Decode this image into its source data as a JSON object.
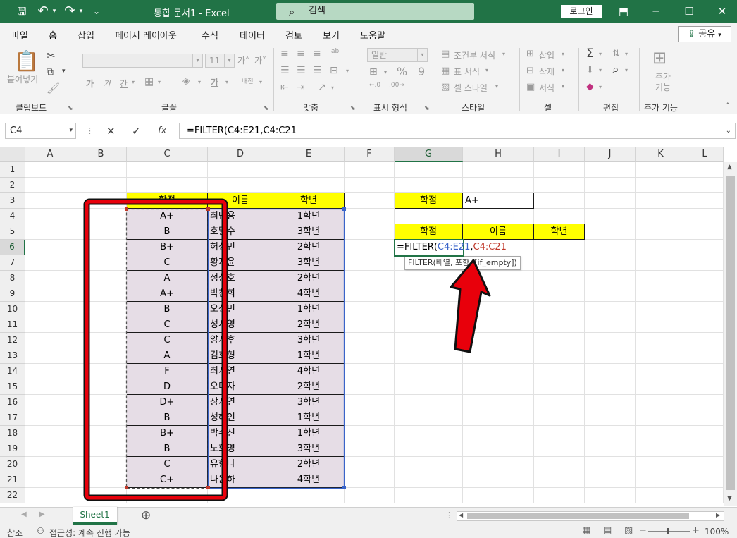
{
  "window": {
    "title": "통합 문서1  -  Excel",
    "search_placeholder": "검색",
    "login_label": "로그인",
    "save_icon": "🖫",
    "undo_icon": "↶",
    "redo_icon": "↷",
    "customize_icon": "⌄",
    "ribbon_display_icon": "⬒",
    "minimize_icon": "─",
    "maximize_icon": "☐",
    "close_icon": "✕"
  },
  "ribbon_tabs": [
    "파일",
    "홈",
    "삽입",
    "페이지 레이아웃",
    "수식",
    "데이터",
    "검토",
    "보기",
    "도움말"
  ],
  "share_label": "공유",
  "ribbon": {
    "groups": [
      "클립보드",
      "글꼴",
      "맞춤",
      "표시 형식",
      "스타일",
      "셀",
      "편집",
      "추가 기능"
    ],
    "paste_label": "붙여넣기",
    "font_size": "11",
    "bold": "가",
    "italic": "가",
    "underline": "간",
    "fill_glyph": "가",
    "phonetic": "내천",
    "grow_font": "가˄",
    "shrink_font": "가˅",
    "wrap_glyph": "ab",
    "number_format": "일반",
    "currency_glyph": "⊞",
    "percent": "%",
    "comma": "9",
    "inc_decimal": ".00\n.0",
    "dec_decimal": ".0\n.00",
    "cond_format": "조건부 서식",
    "format_table": "표 서식",
    "cell_style": "셀 스타일",
    "insert": "삽입",
    "delete": "삭제",
    "format": "서식",
    "sum_glyph": "Σ",
    "addins_label": "추가 기능"
  },
  "formula_bar": {
    "name_box": "C4",
    "cancel_icon": "✕",
    "enter_icon": "✓",
    "fx": "fx",
    "formula": "=FILTER(C4:E21,C4:C21"
  },
  "columns": [
    "A",
    "B",
    "C",
    "D",
    "E",
    "F",
    "G",
    "H",
    "I",
    "J",
    "K",
    "L"
  ],
  "rows": [
    "1",
    "2",
    "3",
    "4",
    "5",
    "6",
    "7",
    "8",
    "9",
    "10",
    "11",
    "12",
    "13",
    "14",
    "15",
    "16",
    "17",
    "18",
    "19",
    "20",
    "21",
    "22"
  ],
  "table": {
    "headers": [
      "학점",
      "이름",
      "학년"
    ],
    "grades": [
      "A+",
      "B",
      "B+",
      "C",
      "A",
      "A+",
      "B",
      "C",
      "C",
      "A",
      "F",
      "D",
      "D+",
      "B",
      "B+",
      "B",
      "C",
      "C+"
    ],
    "names": [
      "최만용",
      "호달수",
      "허성민",
      "황지윤",
      "정상호",
      "박찬희",
      "오성민",
      "성시영",
      "양지후",
      "김호형",
      "최지연",
      "오미자",
      "장지연",
      "성혜인",
      "박수진",
      "노희영",
      "유한나",
      "나윤하"
    ],
    "years": [
      "1학년",
      "3학년",
      "2학년",
      "3학년",
      "2학년",
      "4학년",
      "1학년",
      "2학년",
      "3학년",
      "1학년",
      "4학년",
      "2학년",
      "3학년",
      "1학년",
      "1학년",
      "3학년",
      "2학년",
      "4학년"
    ]
  },
  "criteria": {
    "label": "학점",
    "value": "A+"
  },
  "result_headers": [
    "학점",
    "이름",
    "학년"
  ],
  "editing_cell": {
    "prefix": "=FILTER(",
    "ref1": "C4:E21",
    "comma": ",",
    "ref2": "C4:C21"
  },
  "tooltip": "FILTER(배열, 포함, [if_empty])",
  "sheet_tab": "Sheet1",
  "add_sheet_icon": "⊕",
  "status": {
    "mode": "참조",
    "accessibility": "접근성: 계속 진행 가능",
    "zoom": "100%"
  },
  "colors": {
    "excel_green": "#217346",
    "header_yellow": "#ffff00",
    "highlight_red": "#e8000b",
    "selection_fill": "#e6dde6"
  }
}
